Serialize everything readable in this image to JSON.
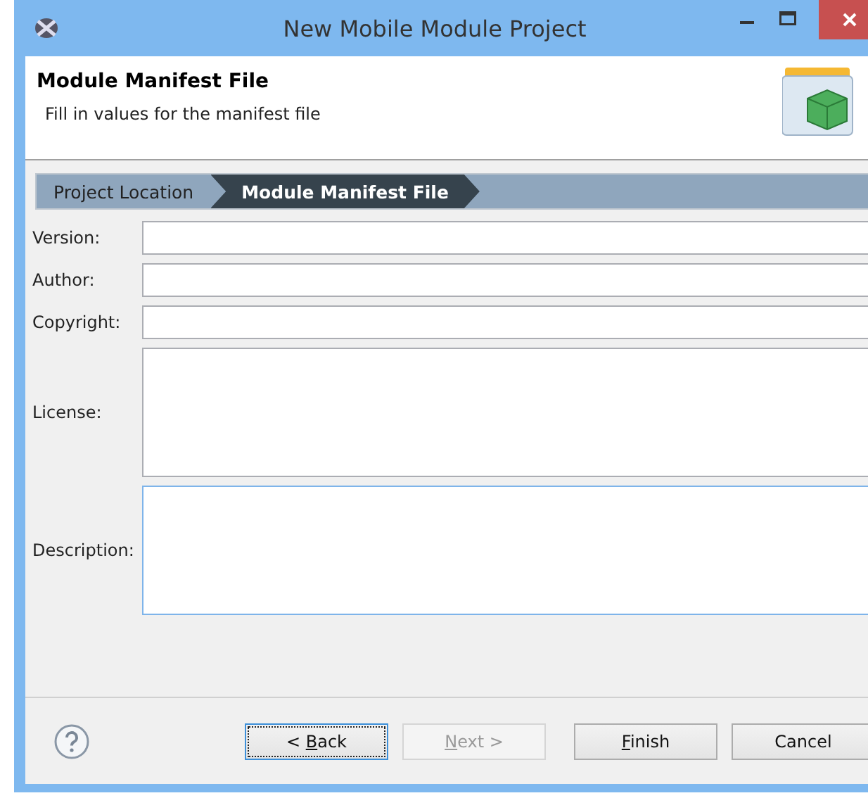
{
  "window": {
    "title": "New Mobile Module Project"
  },
  "header": {
    "title": "Module Manifest File",
    "subtitle": "Fill in values for the manifest file"
  },
  "steps": [
    {
      "label": "Project Location",
      "selected": false
    },
    {
      "label": "Module Manifest File",
      "selected": true
    }
  ],
  "fields": [
    {
      "label": "Version:",
      "kind": "single",
      "focused": false
    },
    {
      "label": "Author:",
      "kind": "single",
      "focused": false
    },
    {
      "label": "Copyright:",
      "kind": "single",
      "focused": false
    },
    {
      "label": "License:",
      "kind": "multi",
      "focused": false
    },
    {
      "label": "Description:",
      "kind": "multi",
      "focused": true
    }
  ],
  "buttons": [
    {
      "before": "< ",
      "mnemonic": "B",
      "after": "ack",
      "disabled": false,
      "focused": true
    },
    {
      "mnemonic": "N",
      "after": "ext >",
      "disabled": true,
      "focused": false
    },
    {
      "mnemonic": "F",
      "after": "inish",
      "disabled": false,
      "focused": false
    },
    {
      "before": "Cancel",
      "disabled": false,
      "focused": false
    }
  ]
}
